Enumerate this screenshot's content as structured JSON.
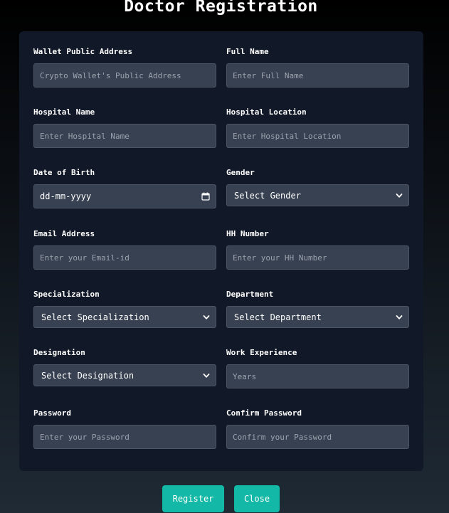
{
  "header": {
    "title": "Doctor Registration"
  },
  "form": {
    "wallet": {
      "label": "Wallet Public Address",
      "placeholder": "Crypto Wallet's Public Address",
      "value": ""
    },
    "full_name": {
      "label": "Full Name",
      "placeholder": "Enter Full Name",
      "value": ""
    },
    "hospital_name": {
      "label": "Hospital Name",
      "placeholder": "Enter Hospital Name",
      "value": ""
    },
    "hospital_location": {
      "label": "Hospital Location",
      "placeholder": "Enter Hospital Location",
      "value": ""
    },
    "dob": {
      "label": "Date of Birth",
      "display": "dd-mm-yyyy",
      "icon": "calendar-icon"
    },
    "gender": {
      "label": "Gender",
      "selected": "Select Gender",
      "icon": "chevron-down-icon"
    },
    "email": {
      "label": "Email Address",
      "placeholder": "Enter your Email-id",
      "value": ""
    },
    "hh_number": {
      "label": "HH Number",
      "placeholder": "Enter your HH Number",
      "value": ""
    },
    "specialization": {
      "label": "Specialization",
      "selected": "Select Specialization",
      "icon": "chevron-down-icon"
    },
    "department": {
      "label": "Department",
      "selected": "Select Department",
      "icon": "chevron-down-icon"
    },
    "designation": {
      "label": "Designation",
      "selected": "Select Designation",
      "icon": "chevron-down-icon"
    },
    "work_experience": {
      "label": "Work Experience",
      "placeholder": "Years",
      "value": ""
    },
    "password": {
      "label": "Password",
      "placeholder": "Enter your Password",
      "value": ""
    },
    "confirm_password": {
      "label": "Confirm Password",
      "placeholder": "Confirm your Password",
      "value": ""
    }
  },
  "actions": {
    "register_label": "Register",
    "close_label": "Close"
  },
  "colors": {
    "background_top": "#000000",
    "background_bottom": "#1f2a35",
    "card": "#111827",
    "input": "#374151",
    "input_border": "#4b5563",
    "placeholder": "#9ca3af",
    "accent": "#14b8a6"
  }
}
